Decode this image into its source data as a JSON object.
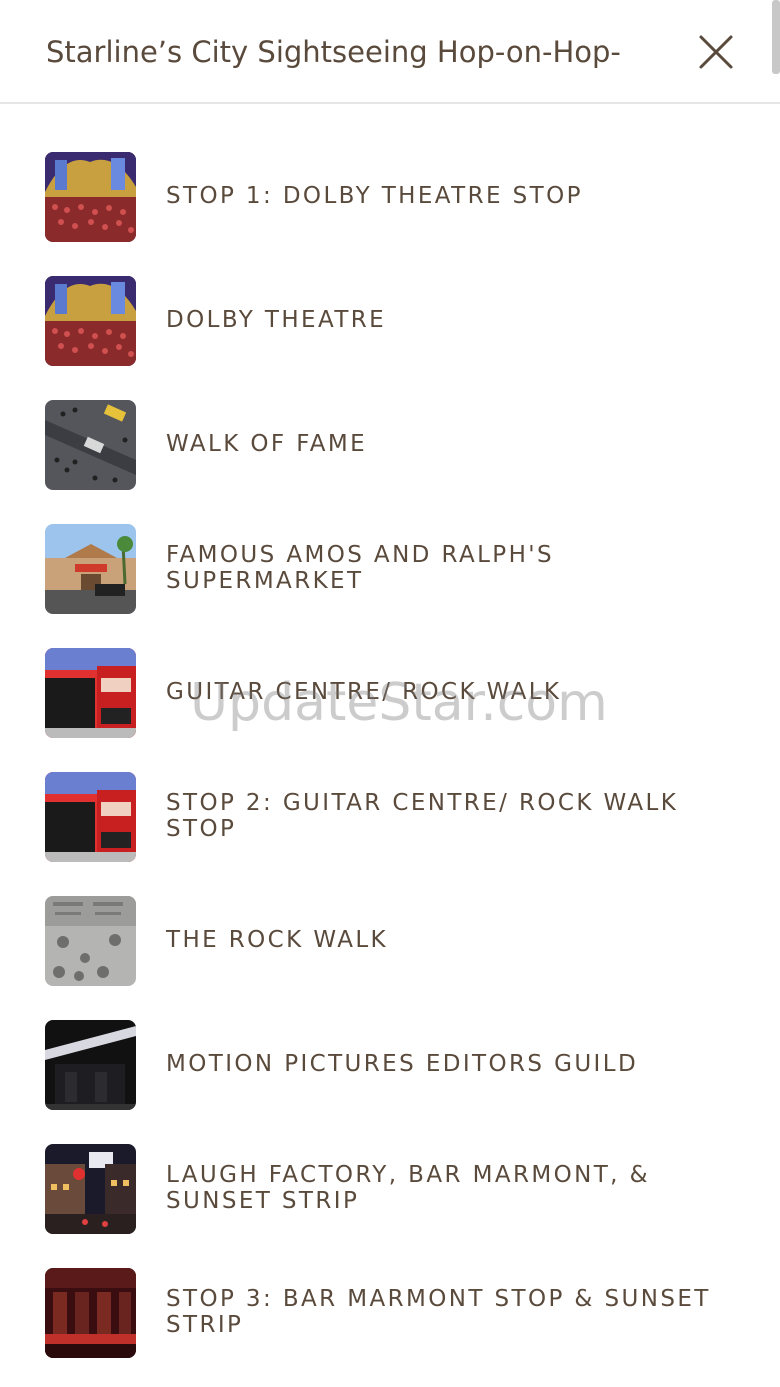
{
  "header": {
    "title": "Starline’s City Sightseeing Hop-on-Hop-",
    "close_icon": "close-icon"
  },
  "stops": [
    {
      "label": "STOP 1: DOLBY THEATRE STOP",
      "thumbnail": "theatre-interior"
    },
    {
      "label": "DOLBY THEATRE",
      "thumbnail": "theatre-interior"
    },
    {
      "label": "WALK OF FAME",
      "thumbnail": "street-aerial"
    },
    {
      "label": "FAMOUS AMOS AND RALPH'S SUPERMARKET",
      "thumbnail": "supermarket-exterior"
    },
    {
      "label": "GUITAR CENTRE/ ROCK WALK",
      "thumbnail": "red-bus"
    },
    {
      "label": "STOP 2: GUITAR CENTRE/ ROCK WALK STOP",
      "thumbnail": "red-bus"
    },
    {
      "label": "THE ROCK WALK",
      "thumbnail": "handprints"
    },
    {
      "label": "MOTION PICTURES EDITORS GUILD",
      "thumbnail": "night-building"
    },
    {
      "label": "LAUGH FACTORY, BAR MARMONT, & SUNSET STRIP",
      "thumbnail": "night-street"
    },
    {
      "label": "STOP 3: BAR MARMONT STOP & SUNSET STRIP",
      "thumbnail": "bar-interior"
    }
  ],
  "watermark": "UpdateStar.com",
  "colors": {
    "text": "#5a4a3c",
    "divider": "#e6e6e6",
    "background": "#ffffff"
  }
}
